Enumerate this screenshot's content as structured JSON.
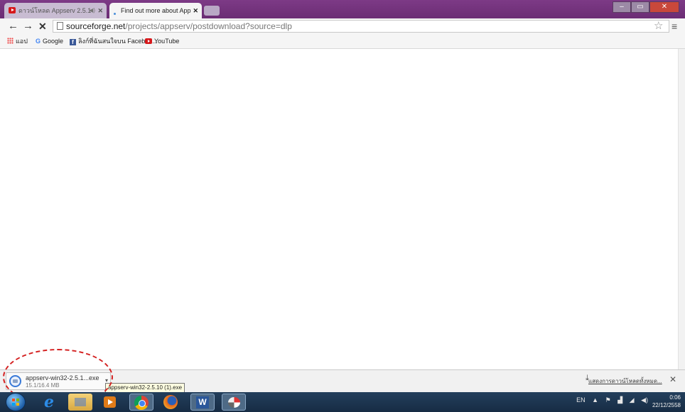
{
  "tabs": [
    {
      "label": "ดาวน์โหลด Appserv 2.5.1",
      "audio_icon": "◀)",
      "close": "✕"
    },
    {
      "label": "Find out more about App",
      "close": "✕"
    }
  ],
  "window_controls": {
    "minimize": "–",
    "maximize": "▭",
    "close": "✕"
  },
  "toolbar": {
    "back": "←",
    "forward": "→",
    "stop": "✕",
    "url_host": "sourceforge.net",
    "url_path": "/projects/appserv/postdownload?source=dlp",
    "star": "☆",
    "menu": "≡"
  },
  "bookmarks": [
    {
      "label": "แอป",
      "icon": "apps-grid-icon"
    },
    {
      "label": "Google",
      "icon": "google-icon"
    },
    {
      "label": "ลิงก์ที่ฉันสนใจบน Faceboo...",
      "icon": "facebook-icon"
    },
    {
      "label": "YouTube",
      "icon": "youtube-icon"
    }
  ],
  "download": {
    "filename": "appserv-win32-2.5.1...exe",
    "size": "15.1/16.4 MB",
    "tooltip": "appserv-win32-2.5.10 (1).exe",
    "arrow": "▾",
    "show_all": "แสดงการดาวน์โหลดทั้งหมด...",
    "show_all_icon": "⤓",
    "close": "✕"
  },
  "taskbar": {
    "ie_label": "e",
    "tray": {
      "lang": "EN",
      "up": "▲",
      "flag": "⚑",
      "net": "▟",
      "signal": "◢",
      "volume": "◀)"
    },
    "clock_time": "0:06",
    "clock_date": "22/12/2558"
  },
  "colors": {
    "title_bar": "#6b2d74",
    "download_highlight": "#d42020",
    "taskbar": "#1b3450"
  }
}
